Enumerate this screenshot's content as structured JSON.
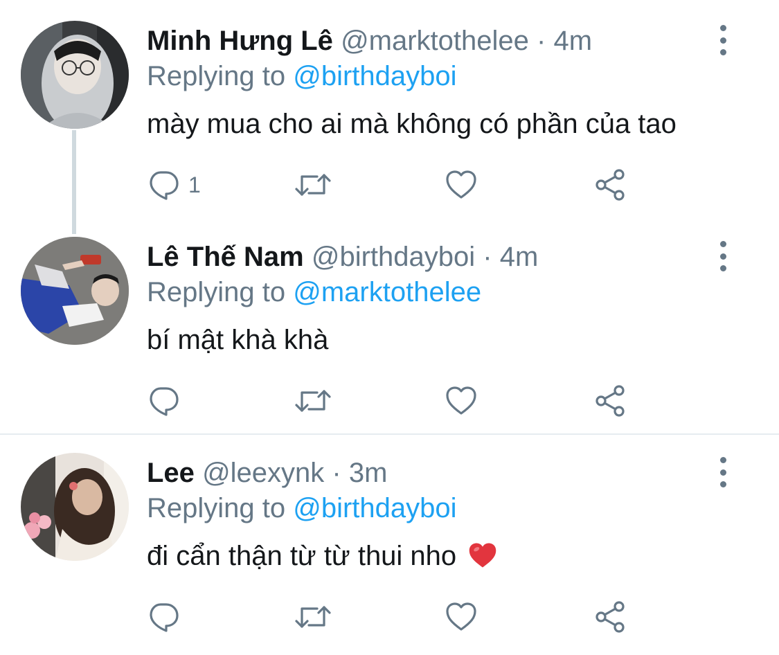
{
  "tweets": [
    {
      "name": "Minh Hưng Lê",
      "handle": "@marktothelee",
      "time": "· 4m",
      "replying_prefix": "Replying to",
      "replying_to": "@birthdayboi",
      "text": "mày mua cho ai mà không có phần của tao",
      "reply_count": "1"
    },
    {
      "name": "Lê Thế Nam",
      "handle": "@birthdayboi",
      "time": "· 4m",
      "replying_prefix": "Replying to",
      "replying_to": "@marktothelee",
      "text": "bí mật khà khà",
      "reply_count": ""
    },
    {
      "name": "Lee",
      "handle": "@leexynk",
      "time": "· 3m",
      "replying_prefix": "Replying to",
      "replying_to": "@birthdayboi",
      "text": "đi cẩn thận từ từ thui nho",
      "reply_count": ""
    }
  ],
  "icons": {
    "reply": "reply-icon",
    "retweet": "retweet-icon",
    "like": "like-icon",
    "share": "share-icon",
    "more": "more-icon",
    "emoji": "red-heart-emoji"
  },
  "colors": {
    "name": "#14171a",
    "meta": "#657786",
    "mention": "#1da1f2",
    "thread_line": "#cfd9de",
    "divider": "#e6ecf0",
    "emoji_heart": "#e2353e"
  }
}
